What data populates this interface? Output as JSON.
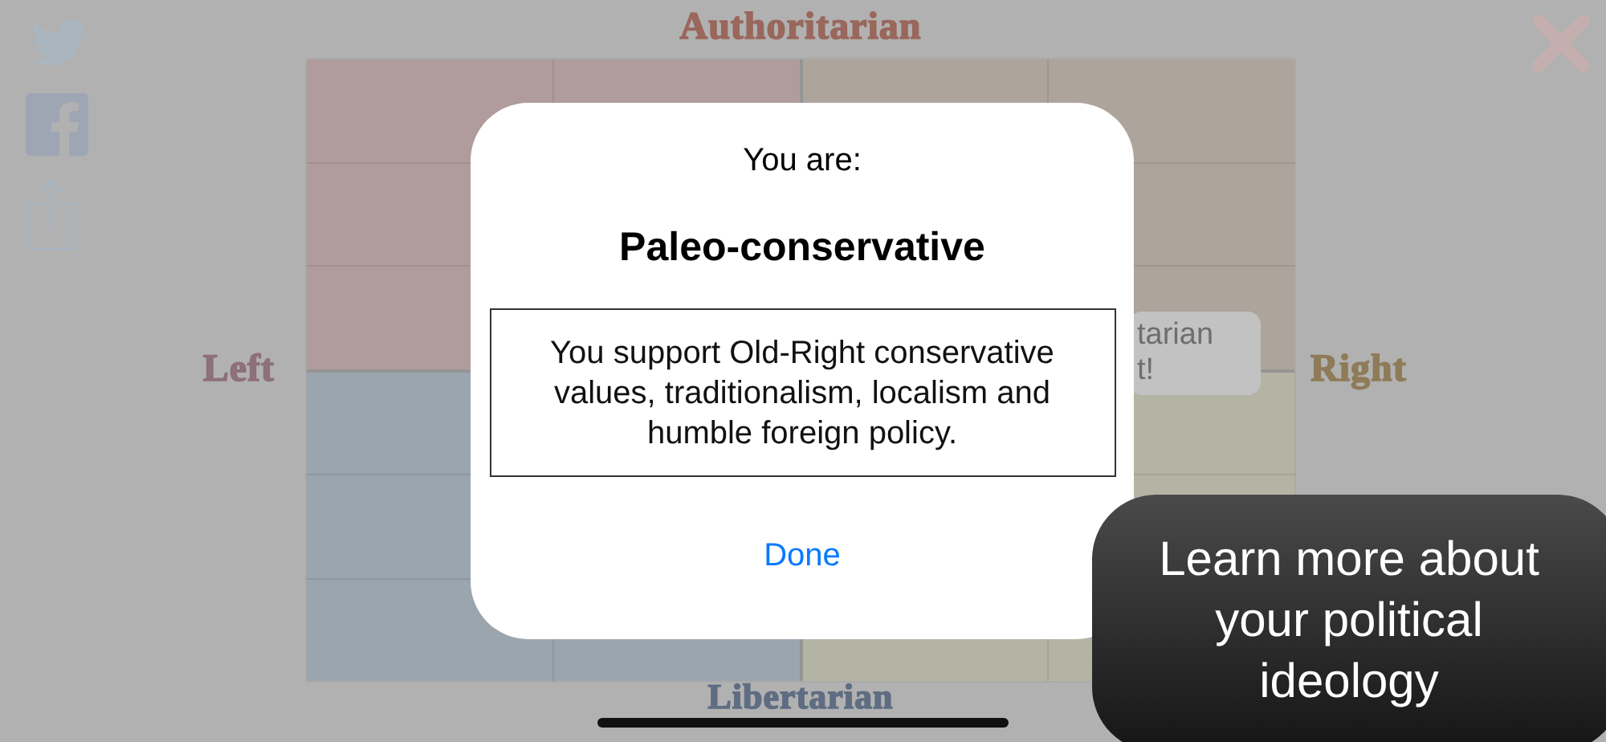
{
  "compass": {
    "top_label": "Authoritarian",
    "left_label": "Left",
    "right_label": "Right",
    "bottom_label": "Libertarian",
    "quadrants": [
      {
        "color": "#b09c9c"
      },
      {
        "color": "#ada49c"
      },
      {
        "color": "#9ba5ae"
      },
      {
        "color": "#b3b4a4"
      }
    ],
    "callout": {
      "lines": [
        "tarian",
        "t!"
      ]
    }
  },
  "dialog": {
    "heading": "You are:",
    "title": "Paleo-conservative",
    "description": "You support Old-Right conservative values, traditionalism, localism and humble foreign policy.",
    "button": "Done"
  },
  "tip": {
    "text": "Learn more about your political ideology"
  }
}
